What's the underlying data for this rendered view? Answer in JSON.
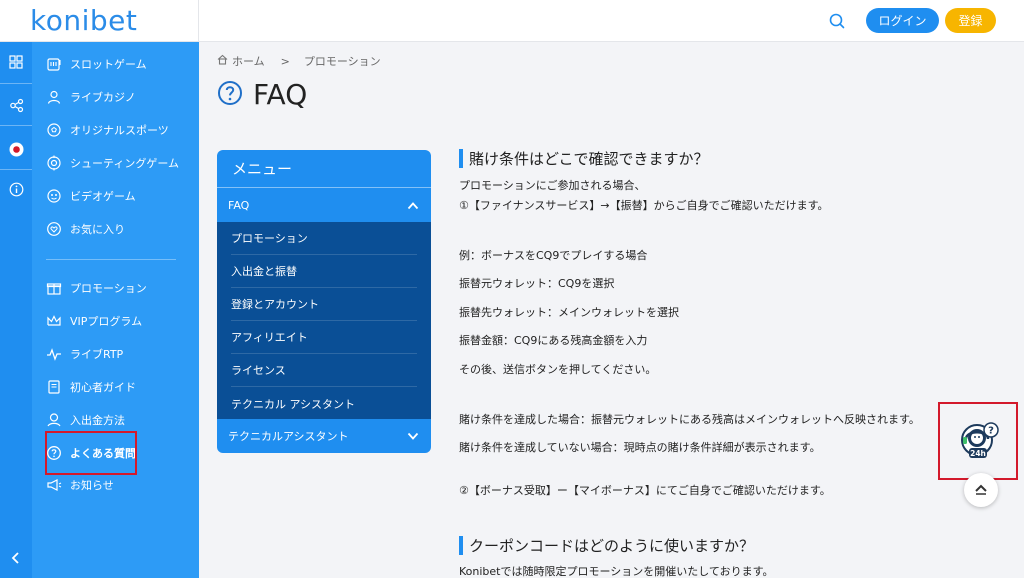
{
  "header": {
    "logo": "konibet",
    "login_label": "ログイン",
    "register_label": "登録"
  },
  "sidebar": {
    "items": [
      {
        "label": "スロットゲーム",
        "icon": "slot-icon"
      },
      {
        "label": "ライブカジノ",
        "icon": "dealer-icon"
      },
      {
        "label": "オリジナルスポーツ",
        "icon": "ball-icon"
      },
      {
        "label": "シューティングゲーム",
        "icon": "target-icon"
      },
      {
        "label": "ビデオゲーム",
        "icon": "gamepad-icon"
      },
      {
        "label": "お気に入り",
        "icon": "heart-icon"
      },
      {
        "label": "プロモーション",
        "icon": "gift-icon"
      },
      {
        "label": "VIPプログラム",
        "icon": "crown-icon"
      },
      {
        "label": "ライブRTP",
        "icon": "pulse-icon"
      },
      {
        "label": "初心者ガイド",
        "icon": "book-icon"
      },
      {
        "label": "入出金方法",
        "icon": "money-icon"
      },
      {
        "label": "よくある質問",
        "icon": "question-icon"
      },
      {
        "label": "お知らせ",
        "icon": "megaphone-icon"
      }
    ]
  },
  "breadcrumb": {
    "home": "ホーム",
    "separator": ">",
    "current": "プロモーション"
  },
  "page": {
    "title": "FAQ"
  },
  "menu": {
    "heading": "メニュー",
    "open_category": "FAQ",
    "sub_items": [
      "プロモーション",
      "入出金と振替",
      "登録とアカウント",
      "アフィリエイト",
      "ライセンス",
      "テクニカル アシスタント"
    ],
    "closed_category": "テクニカルアシスタント"
  },
  "content": {
    "q1": "賭け条件はどこで確認できますか？",
    "q1_lines": [
      "プロモーションにご参加される場合、",
      "①【ファイナンスサービス】→【振替】からご自身でご確認いただけます。",
      "例：ボーナスをCQ9でプレイする場合",
      "振替元ウォレット：CQ9を選択",
      "振替先ウォレット：メインウォレットを選択",
      "振替金額：CQ9にある残高金額を入力",
      "その後、送信ボタンを押してください。",
      "賭け条件を達成した場合：振替元ウォレットにある残高はメインウォレットへ反映されます。",
      "賭け条件を達成していない場合：現時点の賭け条件詳細が表示されます。",
      "②【ボーナス受取】ー【マイボーナス】にてご自身でご確認いただけます。"
    ],
    "q2": "クーポンコードはどのように使いますか？",
    "q2_lines": [
      "Konibetでは随時限定プロモーションを開催いたしております。"
    ]
  },
  "widget": {
    "support_badge": "24h"
  },
  "colors": {
    "primary": "#1f8ef0",
    "sidebar": "#2d9bf6",
    "menu_dark": "#0a4f96",
    "register": "#f7b500",
    "highlight": "#d3192b"
  }
}
